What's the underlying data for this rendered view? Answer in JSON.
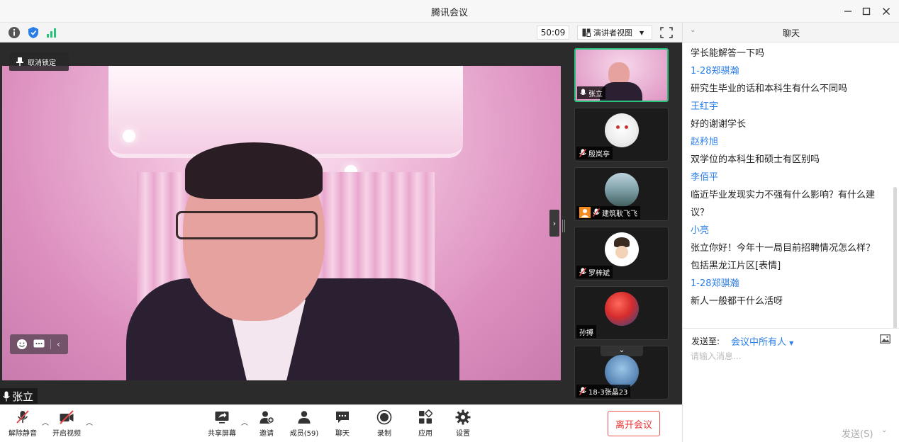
{
  "window": {
    "title": "腾讯会议"
  },
  "topbar": {
    "timer": "50:09",
    "view_mode": "演讲者视图"
  },
  "video": {
    "unpin_label": "取消锁定",
    "speaker_name": "张立"
  },
  "participants": [
    {
      "name": "张立",
      "active": true
    },
    {
      "name": "殷岚亭"
    },
    {
      "name": "建筑耿飞飞"
    },
    {
      "name": "罗梓斌"
    },
    {
      "name": "孙搏"
    },
    {
      "name": "18-3张晶23"
    }
  ],
  "toolbar": {
    "unmute": "解除静音",
    "start_video": "开启视频",
    "share_screen": "共享屏幕",
    "invite": "邀请",
    "members": "成员(59)",
    "chat": "聊天",
    "record": "录制",
    "apps": "应用",
    "settings": "设置",
    "leave": "离开会议"
  },
  "chat": {
    "title": "聊天",
    "lines": [
      {
        "kind": "msg",
        "text": "学长能解答一下吗"
      },
      {
        "kind": "sender",
        "text": "1-28郑骐瀚"
      },
      {
        "kind": "msg",
        "text": "研究生毕业的话和本科生有什么不同吗"
      },
      {
        "kind": "sender",
        "text": "王红宇"
      },
      {
        "kind": "msg",
        "text": "好的谢谢学长"
      },
      {
        "kind": "sender",
        "text": "赵矜旭"
      },
      {
        "kind": "msg",
        "text": "双学位的本科生和硕士有区别吗"
      },
      {
        "kind": "sender",
        "text": "李佰平"
      },
      {
        "kind": "msg",
        "text": "临近毕业发现实力不强有什么影响？有什么建"
      },
      {
        "kind": "msg",
        "text": "议？"
      },
      {
        "kind": "sender",
        "text": "小亮"
      },
      {
        "kind": "msg",
        "text": "张立你好！今年十一局目前招聘情况怎么样？"
      },
      {
        "kind": "msg",
        "text": "包括黑龙江片区[表情]"
      },
      {
        "kind": "sender",
        "text": "1-28郑骐瀚"
      },
      {
        "kind": "msg",
        "text": "新人一般都干什么活呀"
      }
    ],
    "send_to_label": "发送至:",
    "send_to_target": "会议中所有人",
    "input_placeholder": "请输入消息...",
    "send_button": "发送(S)"
  },
  "colors": {
    "accent_blue": "#2a7ee8",
    "active_green": "#27c27c",
    "leave_red": "#e33333",
    "muted_red": "#e04545"
  }
}
